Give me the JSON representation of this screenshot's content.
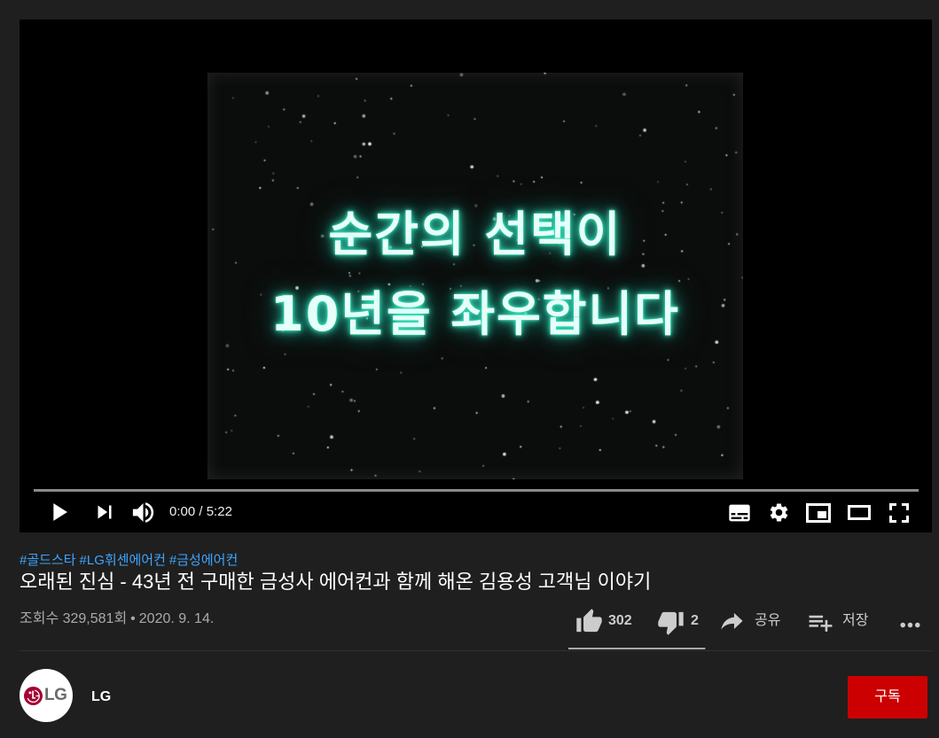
{
  "player": {
    "frame_text": [
      "순간의 선택이",
      "10년을 좌우합니다"
    ],
    "progress_fraction": 0,
    "time": {
      "current": "0:00",
      "separator": " / ",
      "duration": "5:22"
    },
    "controls": {
      "left": [
        "play-icon",
        "next-icon",
        "volume-icon"
      ],
      "right": [
        "subtitles-icon",
        "settings-icon",
        "miniplayer-icon",
        "theater-mode-icon",
        "fullscreen-icon"
      ]
    }
  },
  "video_info": {
    "hashtags": [
      "#골드스타",
      "#LG휘센에어컨",
      "#금성에어컨"
    ],
    "title": "오래된 진심 - 43년 전 구매한 금성사 에어컨과 함께 해온 김용성 고객님 이야기",
    "views": "조회수 329,581회",
    "date_separator": "•",
    "date": "2020. 9. 14.",
    "actions": {
      "like": {
        "icon": "thumb-up-icon",
        "label": "302"
      },
      "dislike": {
        "icon": "thumb-down-icon",
        "label": "2"
      },
      "share": {
        "icon": "share-icon",
        "label": "공유"
      },
      "save": {
        "icon": "playlist-add-icon",
        "label": "저장"
      },
      "more": {
        "icon": "more-horiz-icon"
      }
    },
    "sentiment_like_fraction": 0.993
  },
  "channel": {
    "name": "LG",
    "logo_text": "LG",
    "avatar_icon": "lg-logo-icon"
  },
  "subscribe": {
    "label": "구독"
  },
  "colors": {
    "page_background": "#1f1f1f",
    "player_background": "#000000",
    "link": "#3ea6ff",
    "subscribe": "#cc0000",
    "text_primary": "#ffffff",
    "text_secondary": "#aaaaaa",
    "action": "#cccccc",
    "divider": "#303030",
    "sentiment": "#a8a8a8",
    "progress_track": "#8a8a8a",
    "progress_played": "#ff0000",
    "frame_text": "#e6fff8",
    "frame_glow": "#38f0c8",
    "lg_red": "#a50034",
    "lg_gray": "#6b6b6b"
  }
}
